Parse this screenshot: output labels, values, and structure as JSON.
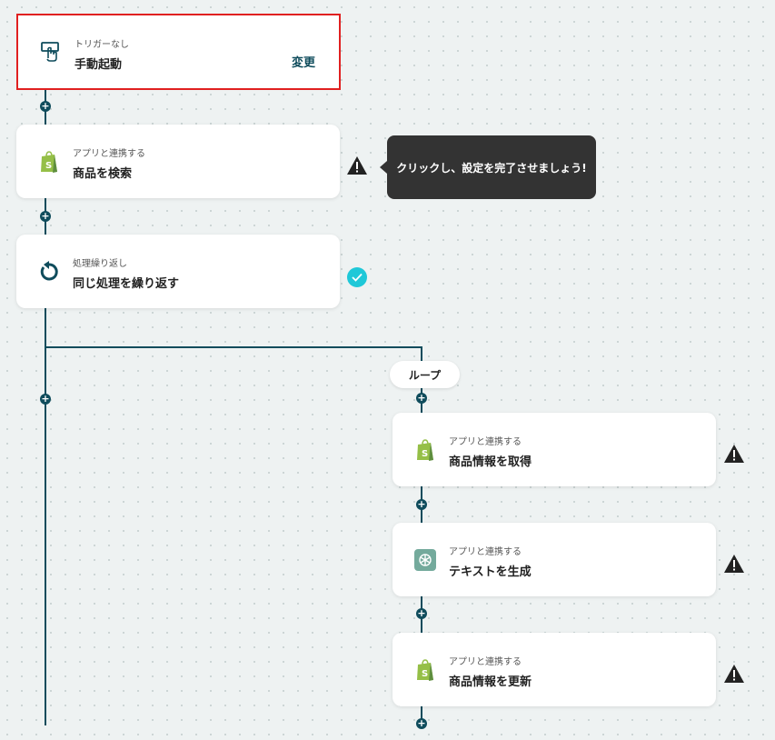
{
  "steps": {
    "trigger": {
      "sub": "トリガーなし",
      "title": "手動起動",
      "action": "変更",
      "icon": "hand-pointer-icon"
    },
    "search": {
      "sub": "アプリと連携する",
      "title": "商品を検索",
      "icon": "shopify-icon"
    },
    "loop": {
      "sub": "処理繰り返し",
      "title": "同じ処理を繰り返す",
      "icon": "repeat-icon"
    },
    "get_info": {
      "sub": "アプリと連携する",
      "title": "商品情報を取得",
      "icon": "shopify-icon"
    },
    "gen_text": {
      "sub": "アプリと連携する",
      "title": "テキストを生成",
      "icon": "openai-icon"
    },
    "update_info": {
      "sub": "アプリと連携する",
      "title": "商品情報を更新",
      "icon": "shopify-icon"
    }
  },
  "tooltip": {
    "text": "クリックし、設定を完了させましょう!"
  },
  "loop_label": "ループ",
  "colors": {
    "accent": "#0f4c5c",
    "selected_border": "#e02020",
    "check": "#1fc8d8",
    "shopify": "#95bf47",
    "openai": "#74aa9c"
  }
}
